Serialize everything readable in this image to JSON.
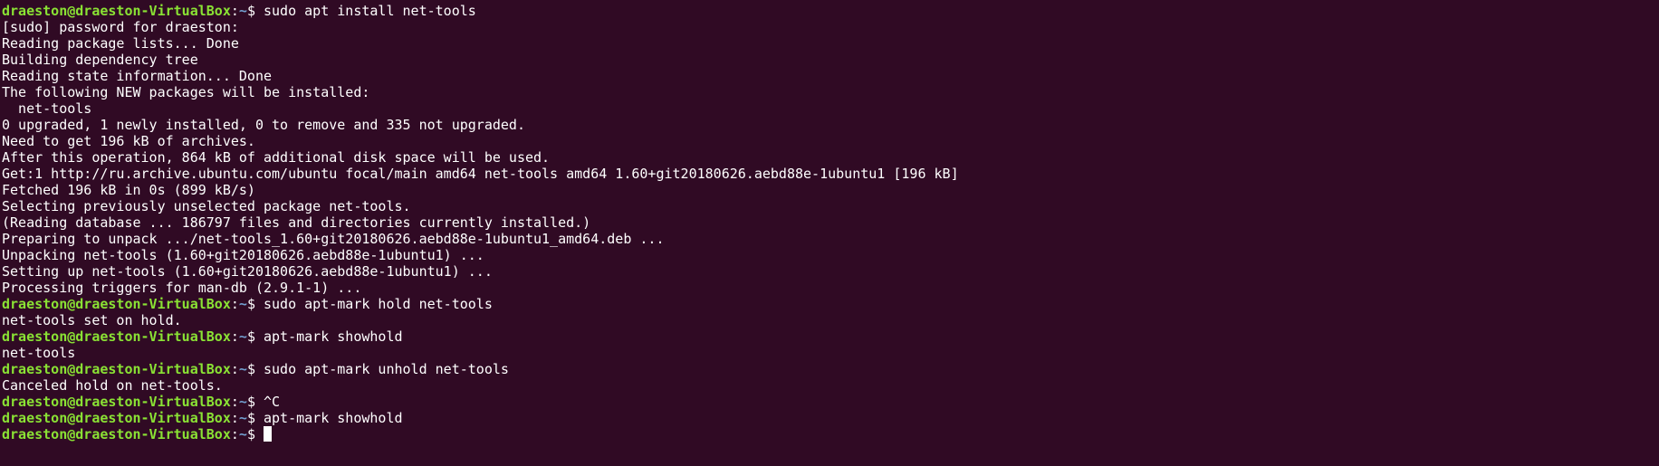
{
  "terminal": {
    "prompt": {
      "user_host": "draeston@draeston-VirtualBox",
      "separator": ":",
      "path": "~",
      "symbol": "$ "
    },
    "lines": [
      {
        "type": "prompt",
        "text": "sudo apt install net-tools"
      },
      {
        "type": "output",
        "text": "[sudo] password for draeston:"
      },
      {
        "type": "output",
        "text": "Reading package lists... Done"
      },
      {
        "type": "output",
        "text": "Building dependency tree"
      },
      {
        "type": "output",
        "text": "Reading state information... Done"
      },
      {
        "type": "output",
        "text": "The following NEW packages will be installed:"
      },
      {
        "type": "output",
        "text": "  net-tools"
      },
      {
        "type": "output",
        "text": "0 upgraded, 1 newly installed, 0 to remove and 335 not upgraded."
      },
      {
        "type": "output",
        "text": "Need to get 196 kB of archives."
      },
      {
        "type": "output",
        "text": "After this operation, 864 kB of additional disk space will be used."
      },
      {
        "type": "output",
        "text": "Get:1 http://ru.archive.ubuntu.com/ubuntu focal/main amd64 net-tools amd64 1.60+git20180626.aebd88e-1ubuntu1 [196 kB]"
      },
      {
        "type": "output",
        "text": "Fetched 196 kB in 0s (899 kB/s)"
      },
      {
        "type": "output",
        "text": "Selecting previously unselected package net-tools."
      },
      {
        "type": "output",
        "text": "(Reading database ... 186797 files and directories currently installed.)"
      },
      {
        "type": "output",
        "text": "Preparing to unpack .../net-tools_1.60+git20180626.aebd88e-1ubuntu1_amd64.deb ..."
      },
      {
        "type": "output",
        "text": "Unpacking net-tools (1.60+git20180626.aebd88e-1ubuntu1) ..."
      },
      {
        "type": "output",
        "text": "Setting up net-tools (1.60+git20180626.aebd88e-1ubuntu1) ..."
      },
      {
        "type": "output",
        "text": "Processing triggers for man-db (2.9.1-1) ..."
      },
      {
        "type": "prompt",
        "text": "sudo apt-mark hold net-tools"
      },
      {
        "type": "output",
        "text": "net-tools set on hold."
      },
      {
        "type": "prompt",
        "text": "apt-mark showhold"
      },
      {
        "type": "output",
        "text": "net-tools"
      },
      {
        "type": "prompt",
        "text": "sudo apt-mark unhold net-tools"
      },
      {
        "type": "output",
        "text": "Canceled hold on net-tools."
      },
      {
        "type": "prompt",
        "text": "^C"
      },
      {
        "type": "prompt",
        "text": "apt-mark showhold"
      },
      {
        "type": "prompt",
        "text": "",
        "cursor": true
      }
    ]
  }
}
